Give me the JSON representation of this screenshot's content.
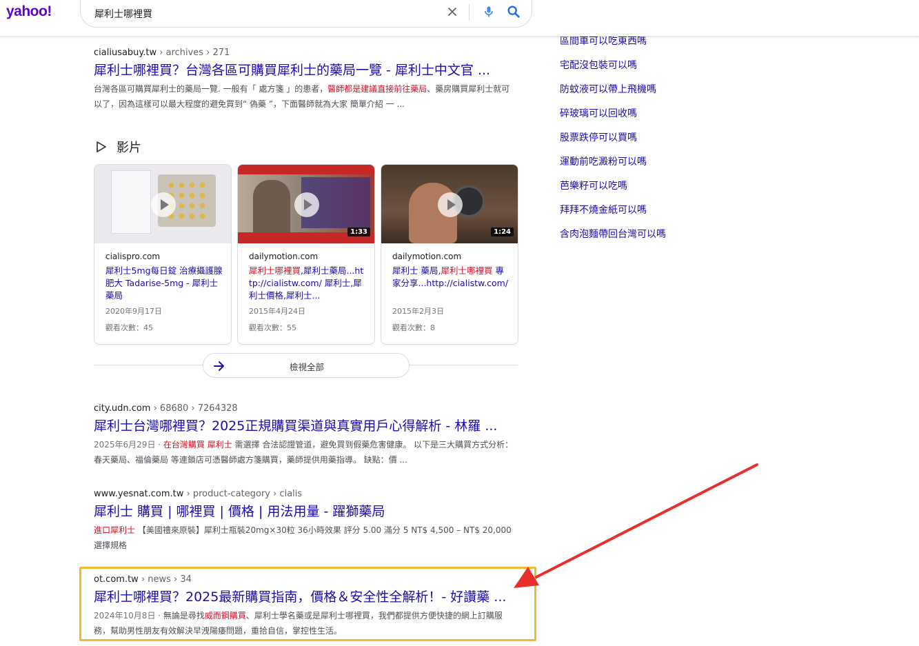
{
  "header": {
    "logo": "yahoo!",
    "query": "犀利士哪裡買"
  },
  "results": [
    {
      "site": "cialiusabuy.tw",
      "path": " › archives › 271",
      "title": "犀利士哪裡買？台灣各區可購買犀利士的藥局一覽 - 犀利士中文官 ...",
      "snippet_pre": "台灣各區可購買犀利士的藥局一覽. 一般有「 處方箋 」的患者，",
      "snippet_hl": "醫師都是建議直接前往藥局",
      "snippet_post": "、藥房購買犀利士就可以了，因為這樣可以最大程度的避免買到“ 偽藥 ”，下面醫師就為大家 簡單介紹 一 ..."
    },
    {
      "site": "city.udn.com",
      "path": " › 68680 › 7264328",
      "title": "犀利士台灣哪裡買？2025正規購買渠道與真實用戶心得解析 - 林羅 ...",
      "date": "2025年6月29日 · ",
      "snippet_hl": "在台灣購買 犀利士",
      "snippet_post": " 需選擇 合法認證管道，避免買到假藥危害健康。 以下是三大購買方式分析： 春天藥局、福倫藥局 等連鎖店可憑醫師處方箋購買，藥師提供用藥指導。 缺點：價 ..."
    },
    {
      "site": "www.yesnat.com.tw",
      "path": " › product-category › cialis",
      "title": "犀利士 購買 | 哪裡買 | 價格 | 用法用量 - 躍獅藥局",
      "snippet_hl": "進口犀利士",
      "snippet_post": " 【美國禮來原裝】犀利士瓶裝20mg×30粒 36小時效果 評分 5.00 滿分 5 NT$ 4,500 – NT$ 20,000 選擇規格"
    },
    {
      "site": "ot.com.tw",
      "path": " › news › 34",
      "title": "犀利士哪裡買？2025最新購買指南，價格＆安全性全解析！- 好讚藥 ...",
      "date": "2024年10月8日 · ",
      "snippet_pre": "無論是尋找",
      "snippet_hl": "威而鋼購買",
      "snippet_post": "、犀利士學名藥或是犀利士哪裡買，我們都提供方便快捷的網上訂購服務，幫助男性朋友有效解決早洩陽痿問題，重拾自信，掌控性生活。"
    }
  ],
  "videos": {
    "label": "影片",
    "view_all": "檢視全部",
    "items": [
      {
        "source": "cialispro.com",
        "title_pre": "犀利士5mg每日錠 治療攝護腺肥大 Tadarise-5mg - 犀利士藥局",
        "title_hl": "",
        "title_post": "",
        "date": "2020年9月17日",
        "views": "觀看次數：45",
        "duration": ""
      },
      {
        "source": "dailymotion.com",
        "title_pre": "",
        "title_hl": "犀利士哪裡買",
        "title_post": ",犀利士藥局...http://cialistw.com/ 犀利士,犀利士價格,犀利士...",
        "date": "2015年4月24日",
        "views": "觀看次數：55",
        "duration": "1:33"
      },
      {
        "source": "dailymotion.com",
        "title_pre": "犀利士 藥局,",
        "title_hl": "犀利士哪裡買",
        "title_post": " 專家分享...http://cialistw.com/",
        "date": "2015年2月3日",
        "views": "觀看次數：8",
        "duration": "1:24"
      }
    ]
  },
  "sidebar": {
    "links": [
      "區間車可以吃東西嗎",
      "宅配沒包裝可以嗎",
      "防蚊液可以帶上飛機嗎",
      "碎玻璃可以回收嗎",
      "股票跌停可以買嗎",
      "運動前吃澱粉可以嗎",
      "芭樂籽可以吃嗎",
      "拜拜不燒金紙可以嗎",
      "含肉泡麵帶回台灣可以嗎"
    ]
  },
  "colors": {
    "logo": "#5f01d1",
    "link": "#1a0dab",
    "highlight_text": "#d50f25",
    "annotation_box": "#f4b731",
    "annotation_arrow": "#e8302a"
  },
  "icons": [
    "clear-icon",
    "mic-icon",
    "search-icon",
    "play-outline-icon",
    "play-icon",
    "arrow-right-icon"
  ]
}
